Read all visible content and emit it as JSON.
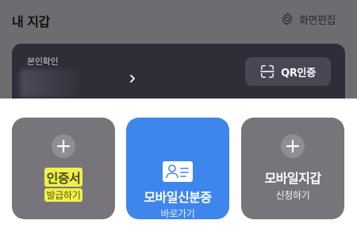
{
  "header": {
    "title": "내 지갑",
    "edit_label": "화면편집",
    "edit_icon": "gear-icon"
  },
  "id_card": {
    "label": "본인확인",
    "arrow_icon": "chevron-right-icon",
    "qr_button": {
      "label": "QR인증",
      "icon": "qr-scan-icon"
    }
  },
  "tiles": [
    {
      "title": "인증서",
      "subtitle": "발급하기",
      "icon": "plus-icon",
      "color": "#77757a",
      "highlighted": true
    },
    {
      "title": "모바일신분증",
      "subtitle": "바로가기",
      "icon": "id-card-icon",
      "color": "#3e86ec",
      "highlighted": false
    },
    {
      "title": "모바일지갑",
      "subtitle": "신청하기",
      "icon": "plus-icon",
      "color": "#77757a",
      "highlighted": false
    }
  ],
  "colors": {
    "dark_overlay": "#6e6c70",
    "card_bg": "#2e2d38",
    "qr_button_bg": "#484756",
    "accent_blue": "#3e86ec",
    "highlight": "#f0f04a"
  }
}
